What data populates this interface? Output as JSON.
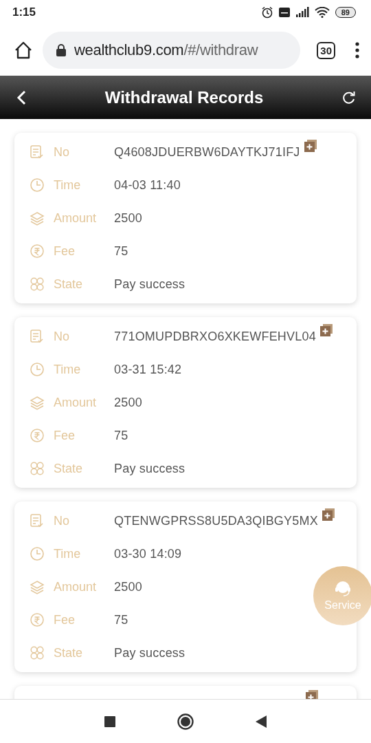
{
  "status_bar": {
    "time": "1:15",
    "battery": "89"
  },
  "browser": {
    "url_host": "wealthclub9.com",
    "url_path": "/#/withdraw",
    "tab_count": "30"
  },
  "header": {
    "title": "Withdrawal Records"
  },
  "records": [
    {
      "fields": [
        {
          "kind": "no",
          "label": "No",
          "value": "Q4608JDUERBW6DAYTKJ71IFJ"
        },
        {
          "kind": "time",
          "label": "Time",
          "value": "04-03 11:40"
        },
        {
          "kind": "amount",
          "label": "Amount",
          "value": "2500"
        },
        {
          "kind": "fee",
          "label": "Fee",
          "value": "75"
        },
        {
          "kind": "state",
          "label": "State",
          "value": "Pay success"
        }
      ]
    },
    {
      "fields": [
        {
          "kind": "no",
          "label": "No",
          "value": "771OMUPDBRXO6XKEWFEHVL04"
        },
        {
          "kind": "time",
          "label": "Time",
          "value": "03-31 15:42"
        },
        {
          "kind": "amount",
          "label": "Amount",
          "value": "2500"
        },
        {
          "kind": "fee",
          "label": "Fee",
          "value": "75"
        },
        {
          "kind": "state",
          "label": "State",
          "value": "Pay success"
        }
      ]
    },
    {
      "fields": [
        {
          "kind": "no",
          "label": "No",
          "value": "QTENWGPRSS8U5DA3QIBGY5MX"
        },
        {
          "kind": "time",
          "label": "Time",
          "value": "03-30 14:09"
        },
        {
          "kind": "amount",
          "label": "Amount",
          "value": "2500"
        },
        {
          "kind": "fee",
          "label": "Fee",
          "value": "75"
        },
        {
          "kind": "state",
          "label": "State",
          "value": "Pay success"
        }
      ]
    }
  ],
  "service_button": {
    "label": "Service"
  }
}
